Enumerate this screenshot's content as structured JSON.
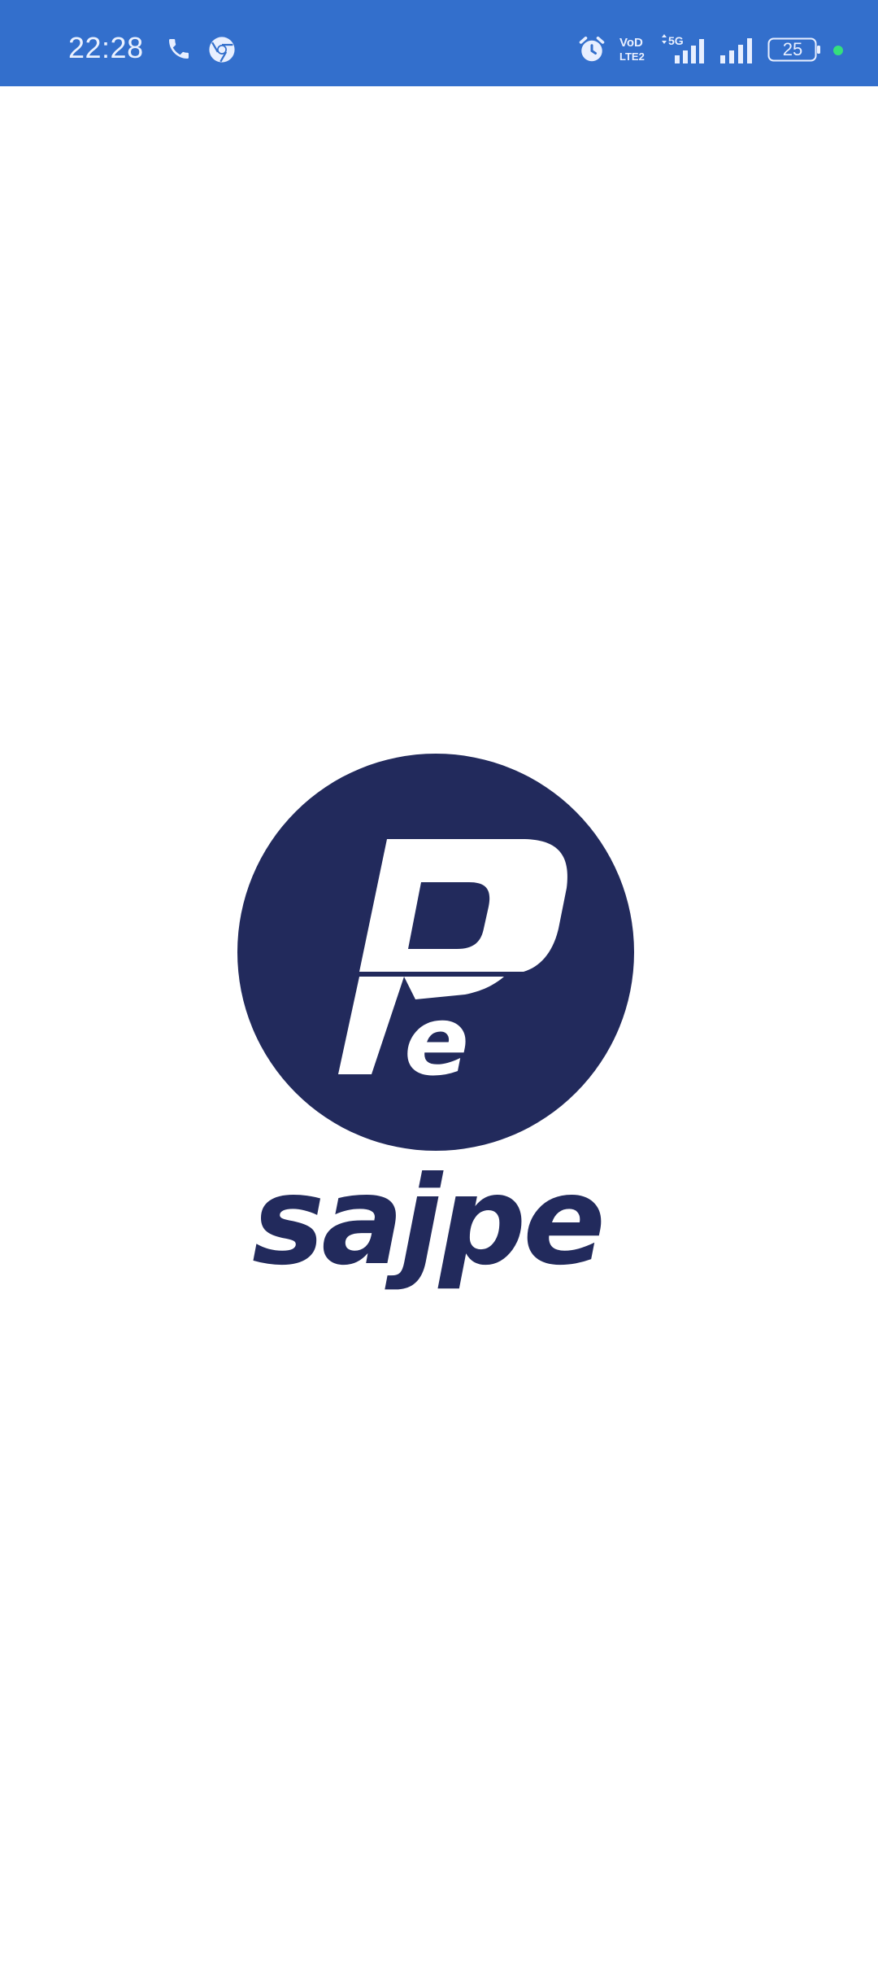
{
  "status_bar": {
    "time": "22:28",
    "battery_level": "25",
    "icons": [
      "call-icon",
      "chrome-icon",
      "alarm-icon",
      "volte-icon",
      "signal-5g-icon",
      "signal-icon",
      "battery-icon",
      "privacy-dot"
    ],
    "background_color": "#336fcc"
  },
  "splash": {
    "logo_name": "sajpe",
    "brand_color": "#222a5c"
  }
}
